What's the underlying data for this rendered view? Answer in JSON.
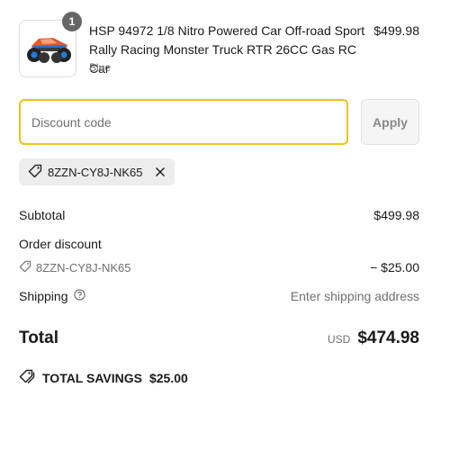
{
  "product": {
    "quantity": "1",
    "name": "HSP 94972 1/8 Nitro Powered Car Off-road Sport Rally Racing Monster Truck RTR 26CC Gas RC Car",
    "variant": "Blue",
    "price": "$499.98",
    "image_icon": "monster-truck-thumbnail"
  },
  "discount": {
    "placeholder": "Discount code",
    "apply_label": "Apply",
    "applied_code": "8ZZN-CY8J-NK65"
  },
  "summary": {
    "subtotal_label": "Subtotal",
    "subtotal_value": "$499.98",
    "order_discount_label": "Order discount",
    "order_discount_code": "8ZZN-CY8J-NK65",
    "order_discount_value": "− $25.00",
    "shipping_label": "Shipping",
    "shipping_value": "Enter shipping address",
    "total_label": "Total",
    "currency": "USD",
    "total_value": "$474.98",
    "savings_label": "TOTAL SAVINGS",
    "savings_value": "$25.00"
  },
  "colors": {
    "input_focus": "#e7c41f",
    "badge": "#666666",
    "muted_text": "#707070"
  }
}
